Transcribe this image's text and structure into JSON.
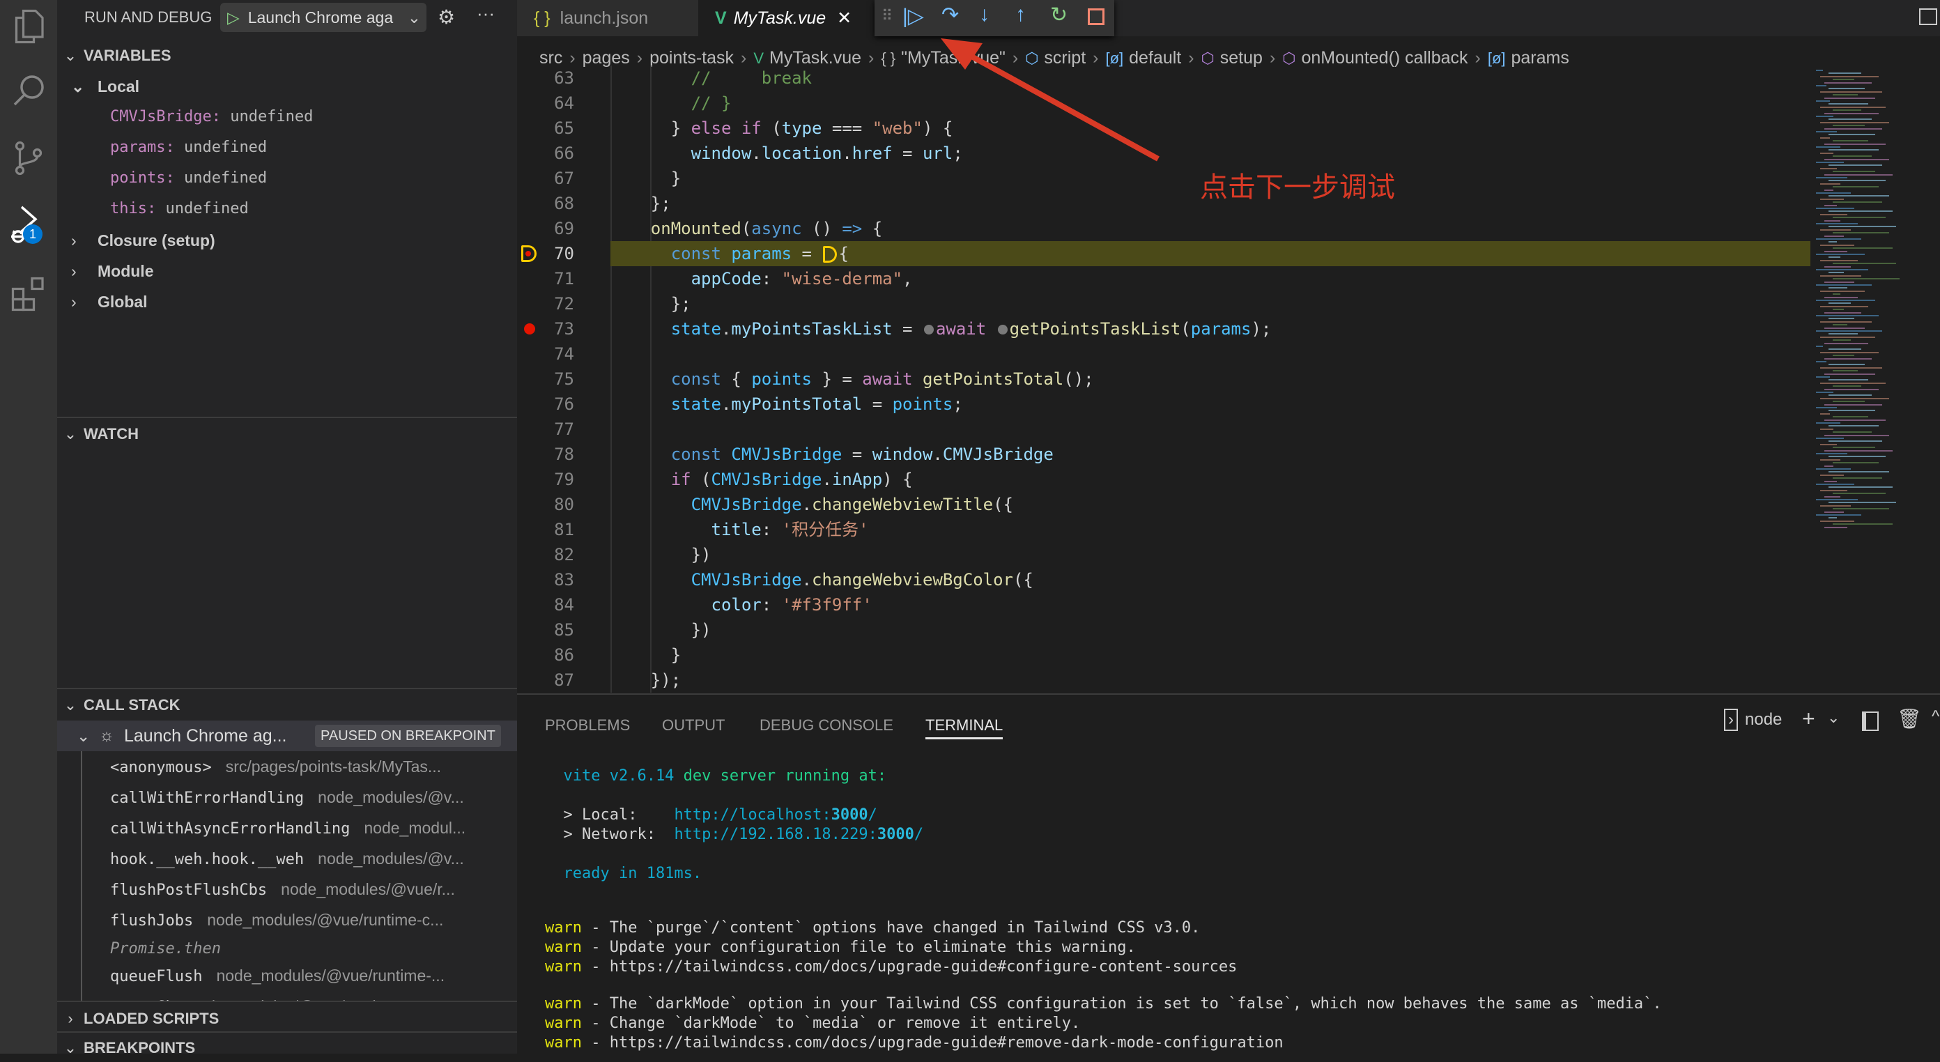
{
  "activity_bar": {
    "items": [
      {
        "icon": "files-icon"
      },
      {
        "icon": "search-icon"
      },
      {
        "icon": "source-control-icon"
      },
      {
        "icon": "run-debug-icon",
        "badge": "1"
      },
      {
        "icon": "extensions-icon"
      }
    ]
  },
  "sidebar": {
    "title": "RUN AND DEBUG",
    "config_select": "Launch Chrome aga",
    "variables": {
      "header": "VARIABLES",
      "local": "Local",
      "items": [
        {
          "name": "CMVJsBridge:",
          "value": "undefined"
        },
        {
          "name": "params:",
          "value": "undefined"
        },
        {
          "name": "points:",
          "value": "undefined"
        },
        {
          "name": "this:",
          "value": "undefined"
        }
      ],
      "scopes": [
        "Closure (setup)",
        "Module",
        "Global"
      ]
    },
    "watch": {
      "header": "WATCH"
    },
    "call_stack": {
      "header": "CALL STACK",
      "session": "Launch Chrome ag...",
      "status": "PAUSED ON BREAKPOINT",
      "frames": [
        {
          "name": "<anonymous>",
          "path": "src/pages/points-task/MyTas..."
        },
        {
          "name": "callWithErrorHandling",
          "path": "node_modules/@v..."
        },
        {
          "name": "callWithAsyncErrorHandling",
          "path": "node_modul..."
        },
        {
          "name": "hook.__weh.hook.__weh",
          "path": "node_modules/@v..."
        },
        {
          "name": "flushPostFlushCbs",
          "path": "node_modules/@vue/r..."
        },
        {
          "name": "flushJobs",
          "path": "node_modules/@vue/runtime-c..."
        },
        {
          "name": "Promise.then",
          "path": "",
          "label": true
        },
        {
          "name": "queueFlush",
          "path": "node_modules/@vue/runtime-..."
        },
        {
          "name": "queueCb",
          "path": "node_modules/@vue/runtime-cor..."
        }
      ]
    },
    "loaded_scripts": {
      "header": "LOADED SCRIPTS"
    },
    "breakpoints": {
      "header": "BREAKPOINTS"
    }
  },
  "tabs": [
    {
      "label": "launch.json",
      "icon": "{ }",
      "active": false
    },
    {
      "label": "MyTask.vue",
      "icon": "vue-icon",
      "active": true
    }
  ],
  "debug_toolbar": [
    "continue-icon",
    "step-over-icon",
    "step-into-icon",
    "step-out-icon",
    "restart-icon",
    "stop-icon"
  ],
  "breadcrumbs": [
    "src",
    "pages",
    "points-task",
    "MyTask.vue",
    "\"MyTask.vue\"",
    "script",
    "default",
    "setup",
    "onMounted() callback",
    "params"
  ],
  "editor": {
    "current_line": 70,
    "breakpoint_line": 73,
    "lines": [
      {
        "n": "63",
        "tokens": [
          [
            "        ",
            "p"
          ],
          [
            "//     break",
            "com"
          ]
        ]
      },
      {
        "n": "64",
        "tokens": [
          [
            "        ",
            "p"
          ],
          [
            "// }",
            "com"
          ]
        ]
      },
      {
        "n": "65",
        "tokens": [
          [
            "      } ",
            "p"
          ],
          [
            "else if",
            "kw2"
          ],
          [
            " (",
            "p"
          ],
          [
            "type",
            "var"
          ],
          [
            " === ",
            "p"
          ],
          [
            "\"web\"",
            "str"
          ],
          [
            ") {",
            "p"
          ]
        ]
      },
      {
        "n": "66",
        "tokens": [
          [
            "        ",
            "p"
          ],
          [
            "window",
            "var"
          ],
          [
            ".",
            "p"
          ],
          [
            "location",
            "var"
          ],
          [
            ".",
            "p"
          ],
          [
            "href",
            "var"
          ],
          [
            " = ",
            "p"
          ],
          [
            "url",
            "var"
          ],
          [
            ";",
            "p"
          ]
        ]
      },
      {
        "n": "67",
        "tokens": [
          [
            "      }",
            "p"
          ]
        ]
      },
      {
        "n": "68",
        "tokens": [
          [
            "    };",
            "p"
          ]
        ]
      },
      {
        "n": "69",
        "tokens": [
          [
            "    ",
            "p"
          ],
          [
            "onMounted",
            "fn"
          ],
          [
            "(",
            "p"
          ],
          [
            "async",
            "kw"
          ],
          [
            " () ",
            "p"
          ],
          [
            "=>",
            "kw"
          ],
          [
            " {",
            "p"
          ]
        ]
      },
      {
        "n": "70",
        "tokens": [
          [
            "      ",
            "p"
          ],
          [
            "const",
            "kw"
          ],
          [
            " ",
            "p"
          ],
          [
            "params",
            "cst"
          ],
          [
            " = ",
            "p"
          ],
          [
            "",
            "ibp"
          ],
          [
            "{",
            "p"
          ]
        ]
      },
      {
        "n": "71",
        "tokens": [
          [
            "        ",
            "p"
          ],
          [
            "appCode",
            "var"
          ],
          [
            ": ",
            "p"
          ],
          [
            "\"wise-derma\"",
            "str"
          ],
          [
            ",",
            "p"
          ]
        ]
      },
      {
        "n": "72",
        "tokens": [
          [
            "      };",
            "p"
          ]
        ]
      },
      {
        "n": "73",
        "tokens": [
          [
            "      ",
            "p"
          ],
          [
            "state",
            "cst"
          ],
          [
            ".",
            "p"
          ],
          [
            "myPointsTaskList",
            "var"
          ],
          [
            " = ",
            "p"
          ],
          [
            "",
            "dot"
          ],
          [
            "await",
            "kw2"
          ],
          [
            " ",
            "p"
          ],
          [
            "",
            "dot"
          ],
          [
            "getPointsTaskList",
            "fn"
          ],
          [
            "(",
            "p"
          ],
          [
            "params",
            "cst"
          ],
          [
            ");",
            "p"
          ]
        ]
      },
      {
        "n": "74",
        "tokens": []
      },
      {
        "n": "75",
        "tokens": [
          [
            "      ",
            "p"
          ],
          [
            "const",
            "kw"
          ],
          [
            " { ",
            "p"
          ],
          [
            "points",
            "cst"
          ],
          [
            " } = ",
            "p"
          ],
          [
            "await",
            "kw2"
          ],
          [
            " ",
            "p"
          ],
          [
            "getPointsTotal",
            "fn"
          ],
          [
            "();",
            "p"
          ]
        ]
      },
      {
        "n": "76",
        "tokens": [
          [
            "      ",
            "p"
          ],
          [
            "state",
            "cst"
          ],
          [
            ".",
            "p"
          ],
          [
            "myPointsTotal",
            "var"
          ],
          [
            " = ",
            "p"
          ],
          [
            "points",
            "cst"
          ],
          [
            ";",
            "p"
          ]
        ]
      },
      {
        "n": "77",
        "tokens": []
      },
      {
        "n": "78",
        "tokens": [
          [
            "      ",
            "p"
          ],
          [
            "const",
            "kw"
          ],
          [
            " ",
            "p"
          ],
          [
            "CMVJsBridge",
            "cst"
          ],
          [
            " = ",
            "p"
          ],
          [
            "window",
            "var"
          ],
          [
            ".",
            "p"
          ],
          [
            "CMVJsBridge",
            "var"
          ]
        ]
      },
      {
        "n": "79",
        "tokens": [
          [
            "      ",
            "p"
          ],
          [
            "if",
            "kw2"
          ],
          [
            " (",
            "p"
          ],
          [
            "CMVJsBridge",
            "cst"
          ],
          [
            ".",
            "p"
          ],
          [
            "inApp",
            "var"
          ],
          [
            ") {",
            "p"
          ]
        ]
      },
      {
        "n": "80",
        "tokens": [
          [
            "        ",
            "p"
          ],
          [
            "CMVJsBridge",
            "cst"
          ],
          [
            ".",
            "p"
          ],
          [
            "changeWebviewTitle",
            "fn"
          ],
          [
            "({",
            "p"
          ]
        ]
      },
      {
        "n": "81",
        "tokens": [
          [
            "          ",
            "p"
          ],
          [
            "title",
            "var"
          ],
          [
            ": ",
            "p"
          ],
          [
            "'积分任务'",
            "str"
          ]
        ]
      },
      {
        "n": "82",
        "tokens": [
          [
            "        })",
            "p"
          ]
        ]
      },
      {
        "n": "83",
        "tokens": [
          [
            "        ",
            "p"
          ],
          [
            "CMVJsBridge",
            "cst"
          ],
          [
            ".",
            "p"
          ],
          [
            "changeWebviewBgColor",
            "fn"
          ],
          [
            "({",
            "p"
          ]
        ]
      },
      {
        "n": "84",
        "tokens": [
          [
            "          ",
            "p"
          ],
          [
            "color",
            "var"
          ],
          [
            ": ",
            "p"
          ],
          [
            "'#f3f9ff'",
            "str"
          ]
        ]
      },
      {
        "n": "85",
        "tokens": [
          [
            "        })",
            "p"
          ]
        ]
      },
      {
        "n": "86",
        "tokens": [
          [
            "      }",
            "p"
          ]
        ]
      },
      {
        "n": "87",
        "tokens": [
          [
            "    });",
            "p"
          ]
        ]
      }
    ]
  },
  "annotation": {
    "text": "点击下一步调试",
    "color": "#d93a26"
  },
  "panel": {
    "tabs": [
      "PROBLEMS",
      "OUTPUT",
      "DEBUG CONSOLE",
      "TERMINAL"
    ],
    "active_tab": "TERMINAL",
    "terminal_name": "node",
    "terminal_lines": [
      [
        [
          "  vite v2.6.14",
          "t-cy"
        ],
        [
          " dev server running at:",
          "t-gr"
        ]
      ],
      [],
      [
        [
          "  > Local:    ",
          "p"
        ],
        [
          "http://localhost:",
          "t-cy"
        ],
        [
          "3000",
          "t-b"
        ],
        [
          "/",
          "t-cy"
        ]
      ],
      [
        [
          "  > Network:  ",
          "p"
        ],
        [
          "http://192.168.18.229:",
          "t-cy"
        ],
        [
          "3000",
          "t-b"
        ],
        [
          "/",
          "t-cy"
        ]
      ],
      [],
      [
        [
          "  ready in 181ms.",
          "t-cy"
        ]
      ],
      [],
      [],
      [
        [
          "warn",
          "t-warn"
        ],
        [
          " - The `purge`/`content` options have changed in Tailwind CSS v3.0.",
          "p"
        ]
      ],
      [
        [
          "warn",
          "t-warn"
        ],
        [
          " - Update your configuration file to eliminate this warning.",
          "p"
        ]
      ],
      [
        [
          "warn",
          "t-warn"
        ],
        [
          " - https://tailwindcss.com/docs/upgrade-guide#configure-content-sources",
          "p"
        ]
      ],
      [],
      [
        [
          "warn",
          "t-warn"
        ],
        [
          " - The `darkMode` option in your Tailwind CSS configuration is set to `false`, which now behaves the same as `media`.",
          "p"
        ]
      ],
      [
        [
          "warn",
          "t-warn"
        ],
        [
          " - Change `darkMode` to `media` or remove it entirely.",
          "p"
        ]
      ],
      [
        [
          "warn",
          "t-warn"
        ],
        [
          " - https://tailwindcss.com/docs/upgrade-guide#remove-dark-mode-configuration",
          "p"
        ]
      ]
    ]
  },
  "colors": {
    "accent": "#0078d4",
    "current_line_bg": "#4b4a18",
    "breakpoint": "#e51400",
    "paused_marker": "#ffcc00"
  }
}
